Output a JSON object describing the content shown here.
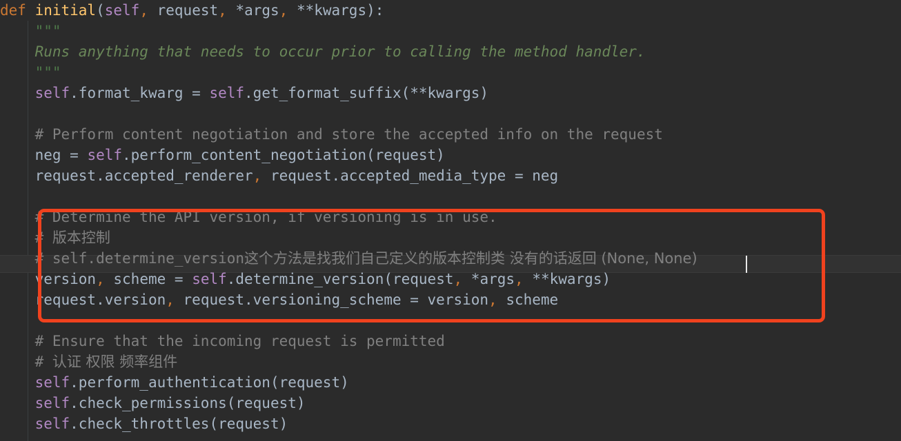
{
  "editor": {
    "language": "python",
    "background_color": "#2b2b2b",
    "current_line_color": "#323232",
    "caret_color": "#e8e8e8",
    "annotation": {
      "type": "rectangle-highlight",
      "color": "#f0421e",
      "border_width_px": 5
    }
  },
  "lines": [
    {
      "n": 1,
      "segments": [
        {
          "t": "kw",
          "s": "def "
        },
        {
          "t": "fn",
          "s": "initial"
        },
        {
          "t": "plain",
          "s": "("
        },
        {
          "t": "self",
          "s": "self"
        },
        {
          "t": "punct",
          "s": ", "
        },
        {
          "t": "plain",
          "s": "request"
        },
        {
          "t": "punct",
          "s": ", "
        },
        {
          "t": "plain",
          "s": "*args"
        },
        {
          "t": "punct",
          "s": ", "
        },
        {
          "t": "plain",
          "s": "**kwargs):"
        }
      ]
    },
    {
      "n": 2,
      "indent": 4,
      "segments": [
        {
          "t": "docq",
          "s": "\"\"\""
        }
      ]
    },
    {
      "n": 3,
      "indent": 4,
      "segments": [
        {
          "t": "doc",
          "s": "Runs anything that needs to occur prior to calling the method handler."
        }
      ]
    },
    {
      "n": 4,
      "indent": 4,
      "segments": [
        {
          "t": "docq",
          "s": "\"\"\""
        }
      ]
    },
    {
      "n": 5,
      "indent": 4,
      "segments": [
        {
          "t": "self",
          "s": "self"
        },
        {
          "t": "plain",
          "s": ".format_kwarg = "
        },
        {
          "t": "self",
          "s": "self"
        },
        {
          "t": "plain",
          "s": ".get_format_suffix(**kwargs)"
        }
      ]
    },
    {
      "n": 6,
      "segments": []
    },
    {
      "n": 7,
      "indent": 4,
      "segments": [
        {
          "t": "comment",
          "s": "# Perform content negotiation and store the accepted info on the request"
        }
      ]
    },
    {
      "n": 8,
      "indent": 4,
      "segments": [
        {
          "t": "plain",
          "s": "neg = "
        },
        {
          "t": "self",
          "s": "self"
        },
        {
          "t": "plain",
          "s": ".perform_content_negotiation(request)"
        }
      ]
    },
    {
      "n": 9,
      "indent": 4,
      "segments": [
        {
          "t": "plain",
          "s": "request.accepted_renderer"
        },
        {
          "t": "punct",
          "s": ","
        },
        {
          "t": "plain",
          "s": " request.accepted_media_type = neg"
        }
      ]
    },
    {
      "n": 10,
      "segments": []
    },
    {
      "n": 11,
      "indent": 4,
      "highlighted": true,
      "segments": [
        {
          "t": "comment",
          "s": "# Determine the API version, if versioning is in use."
        }
      ]
    },
    {
      "n": 12,
      "indent": 4,
      "highlighted": true,
      "segments": [
        {
          "t": "comment",
          "s": "# "
        },
        {
          "t": "cn",
          "s": "版本控制"
        }
      ]
    },
    {
      "n": 13,
      "indent": 4,
      "highlighted": true,
      "current": true,
      "segments": [
        {
          "t": "comment",
          "s": "# self.determine_version"
        },
        {
          "t": "cn",
          "s": "这个方法是找我们自己定义的版本控制类 没有的话返回 (None, None)"
        }
      ]
    },
    {
      "n": 14,
      "indent": 4,
      "highlighted": true,
      "segments": [
        {
          "t": "plain",
          "s": "version"
        },
        {
          "t": "punct",
          "s": ","
        },
        {
          "t": "plain",
          "s": " scheme = "
        },
        {
          "t": "self",
          "s": "self"
        },
        {
          "t": "plain",
          "s": ".determine_version(request"
        },
        {
          "t": "punct",
          "s": ","
        },
        {
          "t": "plain",
          "s": " *args"
        },
        {
          "t": "punct",
          "s": ","
        },
        {
          "t": "plain",
          "s": " **kwargs)"
        }
      ]
    },
    {
      "n": 15,
      "indent": 4,
      "highlighted": true,
      "segments": [
        {
          "t": "plain",
          "s": "request.version"
        },
        {
          "t": "punct",
          "s": ","
        },
        {
          "t": "plain",
          "s": " request.versioning_scheme = version"
        },
        {
          "t": "punct",
          "s": ","
        },
        {
          "t": "plain",
          "s": " scheme"
        }
      ]
    },
    {
      "n": 16,
      "segments": []
    },
    {
      "n": 17,
      "indent": 4,
      "segments": [
        {
          "t": "comment",
          "s": "# Ensure that the incoming request is permitted"
        }
      ]
    },
    {
      "n": 18,
      "indent": 4,
      "segments": [
        {
          "t": "comment",
          "s": "# "
        },
        {
          "t": "cn",
          "s": "认证 权限 频率组件"
        }
      ]
    },
    {
      "n": 19,
      "indent": 4,
      "segments": [
        {
          "t": "self",
          "s": "self"
        },
        {
          "t": "plain",
          "s": ".perform_authentication(request)"
        }
      ]
    },
    {
      "n": 20,
      "indent": 4,
      "segments": [
        {
          "t": "self",
          "s": "self"
        },
        {
          "t": "plain",
          "s": ".check_permissions(request)"
        }
      ]
    },
    {
      "n": 21,
      "indent": 4,
      "segments": [
        {
          "t": "self",
          "s": "self"
        },
        {
          "t": "plain",
          "s": ".check_throttles(request)"
        }
      ]
    }
  ]
}
